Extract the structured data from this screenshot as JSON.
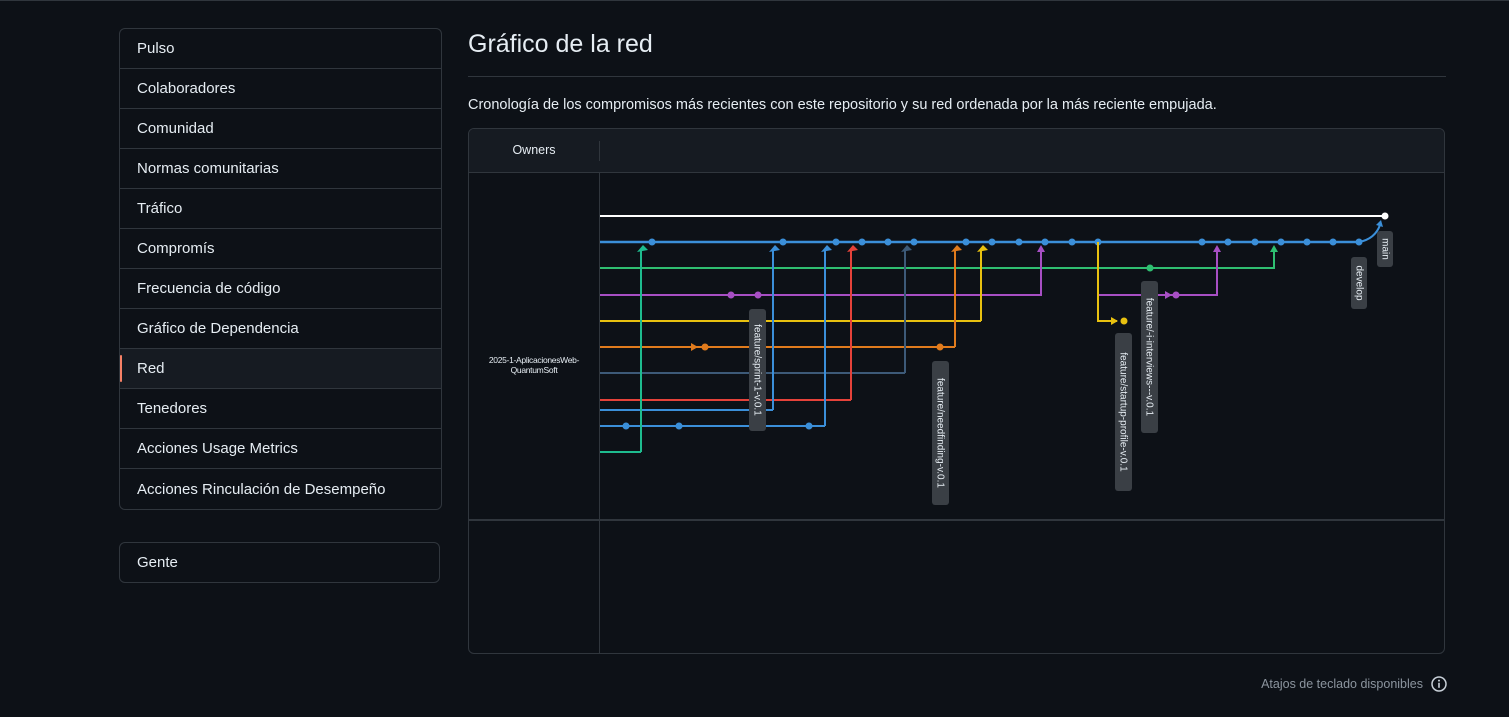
{
  "sidebar": {
    "items": [
      {
        "label": "Pulso"
      },
      {
        "label": "Colaboradores"
      },
      {
        "label": "Comunidad"
      },
      {
        "label": "Normas comunitarias"
      },
      {
        "label": "Tráfico"
      },
      {
        "label": "Compromís"
      },
      {
        "label": "Frecuencia de código"
      },
      {
        "label": "Gráfico de Dependencia"
      },
      {
        "label": "Red",
        "selected": true
      },
      {
        "label": "Tenedores"
      },
      {
        "label": "Acciones Usage Metrics"
      },
      {
        "label": "Acciones Rinculación de Desempeño"
      }
    ],
    "people": "Gente"
  },
  "main": {
    "title": "Gráfico de la red",
    "description": "Cronología de los compromisos más recientes con este repositorio y su red ordenada por la más reciente empujada."
  },
  "graph": {
    "owners_header": "Owners",
    "owner": "2025-1-AplicacionesWeb-QuantumSoft",
    "branch_labels": {
      "main": "main",
      "develop": "develop",
      "sprint": "feature/sprint-1-v.0.1",
      "needfinding": "feature/needfinding-v.0.1",
      "startup": "feature/startup-profile-v.0.1",
      "interviews": "feature/-i-interviews---v.0.1"
    },
    "colors": {
      "main": "#ffffff",
      "develop": "#3b8fd9",
      "green": "#2fbf71",
      "purple": "#a74fc4",
      "yellow": "#e8c110",
      "orange": "#e07b1d",
      "slate": "#2e4a64",
      "red": "#e5423a",
      "teal": "#1ebc8f"
    }
  },
  "footer": {
    "shortcuts": "Atajos de teclado disponibles",
    "icon": "info-icon"
  }
}
